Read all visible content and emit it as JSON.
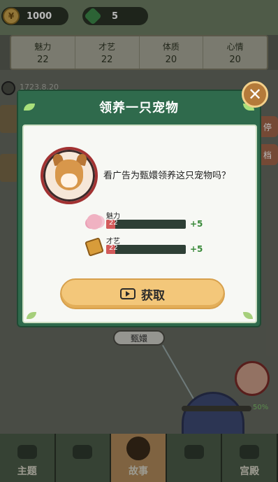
{
  "currency": {
    "coins": "1000",
    "gems": "5"
  },
  "stats": [
    {
      "label": "魅力",
      "value": "22"
    },
    {
      "label": "才艺",
      "value": "22"
    },
    {
      "label": "体质",
      "value": "20"
    },
    {
      "label": "心情",
      "value": "20"
    }
  ],
  "background": {
    "date": "1723.8.20",
    "side_buttons": [
      "停",
      "档"
    ],
    "node_label": "甄嬛",
    "progress_percent": "50%"
  },
  "modal": {
    "title": "领养一只宠物",
    "question": "看广告为甄嬛领养这只宠物吗？",
    "attributes": [
      {
        "name": "魅力",
        "value": "22",
        "gain": "+5",
        "icon": "charm-flower-icon",
        "fill": 0.11
      },
      {
        "name": "才艺",
        "value": "22",
        "gain": "+5",
        "icon": "talent-scroll-icon",
        "fill": 0.11
      }
    ],
    "button_label": "获取",
    "button_icon": "video-ad-icon",
    "close_icon": "close-icon"
  },
  "tabs": [
    "主题",
    "",
    "故事",
    "",
    "宫殿"
  ],
  "colors": {
    "modal_green": "#2f6a4c",
    "button_gold": "#f3c77a",
    "gain_green": "#3a8a3a",
    "bar_red": "#d25a5a"
  }
}
